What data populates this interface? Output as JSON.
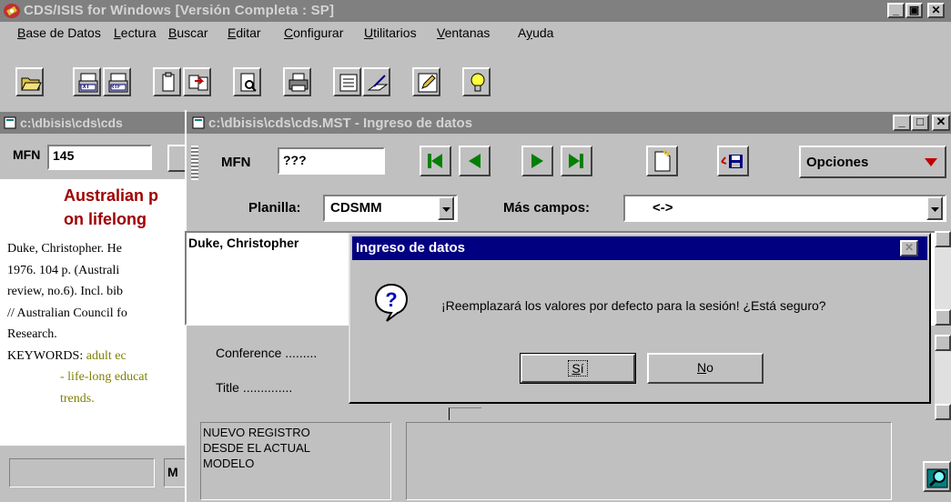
{
  "app": {
    "title": "CDS/ISIS for Windows [Versión Completa : SP]"
  },
  "menu": {
    "items": [
      {
        "pre": "",
        "key": "B",
        "post": "ase de Datos"
      },
      {
        "pre": "",
        "key": "L",
        "post": "ectura"
      },
      {
        "pre": "",
        "key": "B",
        "post": "uscar"
      },
      {
        "pre": "",
        "key": "E",
        "post": "ditar"
      },
      {
        "pre": "",
        "key": "C",
        "post": "onfigurar"
      },
      {
        "pre": "",
        "key": "U",
        "post": "tilitarios"
      },
      {
        "pre": "",
        "key": "V",
        "post": "entanas"
      },
      {
        "pre": "A",
        "key": "y",
        "post": "uda"
      }
    ]
  },
  "toolbar": {
    "txt_label": "TXT",
    "rtf_label": "RTF"
  },
  "back_window": {
    "title": "c:\\dbisis\\cds\\cds",
    "mfn_label": "MFN",
    "mfn_value": "145",
    "heading_line1": "Australian p",
    "heading_line2": "on lifelong",
    "record_lines": [
      "Duke, Christopher. He",
      "1976. 104 p. (Australi",
      "review, no.6). Incl. bib",
      "// Australian Council fo",
      "Research."
    ],
    "keywords_label": "KEYWORDS:",
    "keywords_value": "adult ec",
    "keywords_more": [
      "- life-long educat",
      "trends."
    ],
    "status_partial": "M"
  },
  "entry_window": {
    "title": "c:\\dbisis\\cds\\cds.MST - Ingreso de datos",
    "mfn_label": "MFN",
    "mfn_value": "???",
    "options_label": "Opciones",
    "planilla_label": "Planilla:",
    "planilla_value": "CDSMM",
    "mas_campos_label": "Más campos:",
    "mas_campos_value": "<->",
    "field_author_value": "Duke, Christopher",
    "field_labels": [
      "Conference .........",
      "Title .............."
    ],
    "status_message": "NUEVO REGISTRO\nDESDE EL ACTUAL\nMODELO"
  },
  "dialog": {
    "title": "Ingreso de datos",
    "message": "¡Reemplazará los valores por defecto para la sesión! ¿Está seguro?",
    "yes_label": "Sí",
    "yes_key": "S",
    "yes_rest": "í",
    "no_label": "No",
    "no_key": "N",
    "no_rest": "o"
  },
  "colors": {
    "titlebar_inactive": "#808080",
    "titlebar_active": "#000080",
    "heading_red": "#a00000",
    "keyword_olive": "#808000",
    "nav_green": "#008000",
    "options_arrow": "#c00000"
  }
}
